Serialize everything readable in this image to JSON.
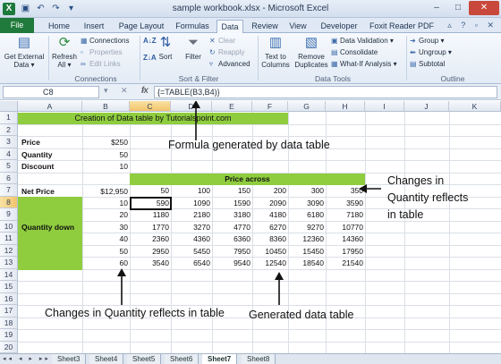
{
  "window": {
    "title": "sample workbook.xlsx - Microsoft Excel",
    "logo": "X",
    "controls": [
      "–",
      "□",
      "✕"
    ]
  },
  "tabs": [
    "File",
    "Home",
    "Insert",
    "Page Layout",
    "Formulas",
    "Data",
    "Review",
    "View",
    "Developer",
    "Foxit Reader PDF"
  ],
  "active_tab": "Data",
  "ribbon": {
    "get_external_data": "Get External Data",
    "refresh_all": "Refresh All",
    "connections": "Connections",
    "properties": "Properties",
    "edit_links": "Edit Links",
    "sort": "Sort",
    "filter": "Filter",
    "clear": "Clear",
    "reapply": "Reapply",
    "advanced": "Advanced",
    "text_to_columns": "Text to Columns",
    "remove_duplicates": "Remove Duplicates",
    "data_validation": "Data Validation",
    "consolidate": "Consolidate",
    "what_if": "What-If Analysis",
    "group": "Group",
    "ungroup": "Ungroup",
    "subtotal": "Subtotal",
    "groups": {
      "connections": "Connections",
      "sort_filter": "Sort & Filter",
      "data_tools": "Data Tools",
      "outline": "Outline"
    }
  },
  "formula_bar": {
    "name_box": "C8",
    "fx": "fx",
    "formula": "{=TABLE(B3,B4)}"
  },
  "columns": [
    "A",
    "B",
    "C",
    "D",
    "E",
    "F",
    "G",
    "H",
    "I",
    "J",
    "K"
  ],
  "rows": [
    "1",
    "2",
    "3",
    "4",
    "5",
    "6",
    "7",
    "8",
    "9",
    "10",
    "11",
    "12",
    "13",
    "14",
    "15",
    "16",
    "17",
    "18",
    "19",
    "20",
    "21",
    "22"
  ],
  "cells": {
    "a1": "Creation of Data table by Tutorialspoint.com",
    "a3": "Price",
    "b3": "$250",
    "a4": "Quantity",
    "b4": "50",
    "a5": "Discount",
    "b5": "10",
    "c6": "Price across",
    "a7": "Net Price",
    "b7": "$12,950",
    "price_across": [
      "50",
      "100",
      "150",
      "200",
      "300",
      "350"
    ],
    "quantity_down_label": "Quantity down",
    "quantity_down": [
      "10",
      "20",
      "30",
      "40",
      "50",
      "60"
    ],
    "table": [
      [
        "590",
        "1090",
        "1590",
        "2090",
        "3090",
        "3590"
      ],
      [
        "1180",
        "2180",
        "3180",
        "4180",
        "6180",
        "7180"
      ],
      [
        "1770",
        "3270",
        "4770",
        "6270",
        "9270",
        "10770"
      ],
      [
        "2360",
        "4360",
        "6360",
        "8360",
        "12360",
        "14360"
      ],
      [
        "2950",
        "5450",
        "7950",
        "10450",
        "15450",
        "17950"
      ],
      [
        "3540",
        "6540",
        "9540",
        "12540",
        "18540",
        "21540"
      ]
    ]
  },
  "annotations": {
    "formula": "Formula generated by data table",
    "changes_right": [
      "Changes in",
      "Quantity reflects",
      "in table"
    ],
    "changes_bottom": "Changes in Quantity reflects in table",
    "generated": "Generated data table"
  },
  "sheets": [
    "Sheet3",
    "Sheet4",
    "Sheet5",
    "Sheet6",
    "Sheet7",
    "Sheet8"
  ],
  "active_sheet": "Sheet7",
  "colors": {
    "highlight": "#8fcd3f",
    "file_tab": "#1f7a3b"
  }
}
